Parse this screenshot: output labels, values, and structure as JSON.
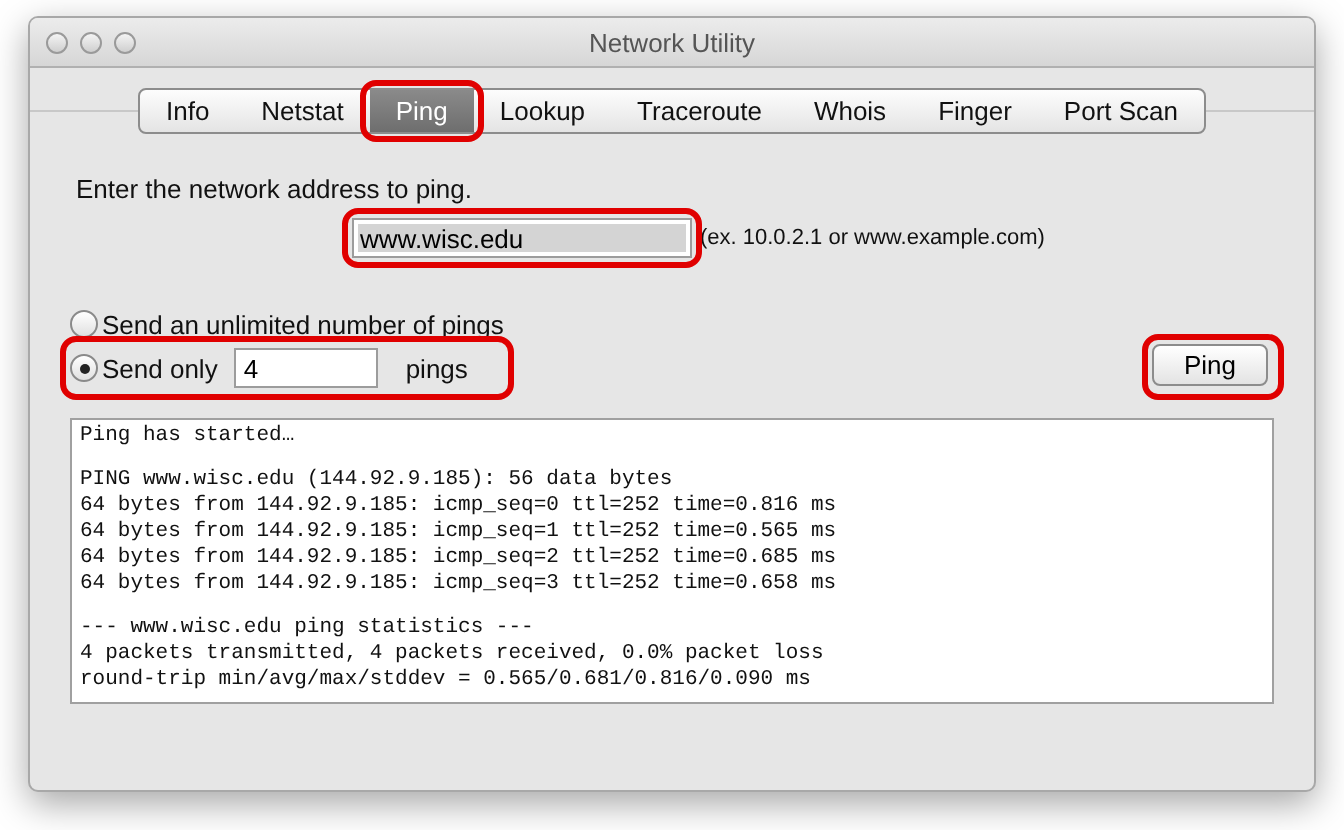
{
  "window": {
    "title": "Network Utility"
  },
  "tabs": [
    {
      "label": "Info",
      "selected": false,
      "highlighted": false
    },
    {
      "label": "Netstat",
      "selected": false,
      "highlighted": false
    },
    {
      "label": "Ping",
      "selected": true,
      "highlighted": true
    },
    {
      "label": "Lookup",
      "selected": false,
      "highlighted": false
    },
    {
      "label": "Traceroute",
      "selected": false,
      "highlighted": false
    },
    {
      "label": "Whois",
      "selected": false,
      "highlighted": false
    },
    {
      "label": "Finger",
      "selected": false,
      "highlighted": false
    },
    {
      "label": "Port Scan",
      "selected": false,
      "highlighted": false
    }
  ],
  "prompt": "Enter the network address to ping.",
  "address": {
    "value": "www.wisc.edu",
    "highlighted": true
  },
  "address_hint": "(ex. 10.0.2.1 or www.example.com)",
  "ping_modes": [
    {
      "kind": "plain",
      "label": "Send an unlimited number of pings",
      "selected": false,
      "highlighted": false
    },
    {
      "kind": "count",
      "label": "Send only",
      "count": "4",
      "suffix": "pings",
      "selected": true,
      "highlighted": true
    }
  ],
  "ping_button": {
    "label": "Ping",
    "highlighted": true
  },
  "output": {
    "blocks": [
      [
        "Ping has started…"
      ],
      [
        "PING www.wisc.edu (144.92.9.185): 56 data bytes",
        "64 bytes from 144.92.9.185: icmp_seq=0 ttl=252 time=0.816 ms",
        "64 bytes from 144.92.9.185: icmp_seq=1 ttl=252 time=0.565 ms",
        "64 bytes from 144.92.9.185: icmp_seq=2 ttl=252 time=0.685 ms",
        "64 bytes from 144.92.9.185: icmp_seq=3 ttl=252 time=0.658 ms"
      ],
      [
        "--- www.wisc.edu ping statistics ---",
        "4 packets transmitted, 4 packets received, 0.0% packet loss",
        "round-trip min/avg/max/stddev = 0.565/0.681/0.816/0.090 ms"
      ]
    ]
  }
}
